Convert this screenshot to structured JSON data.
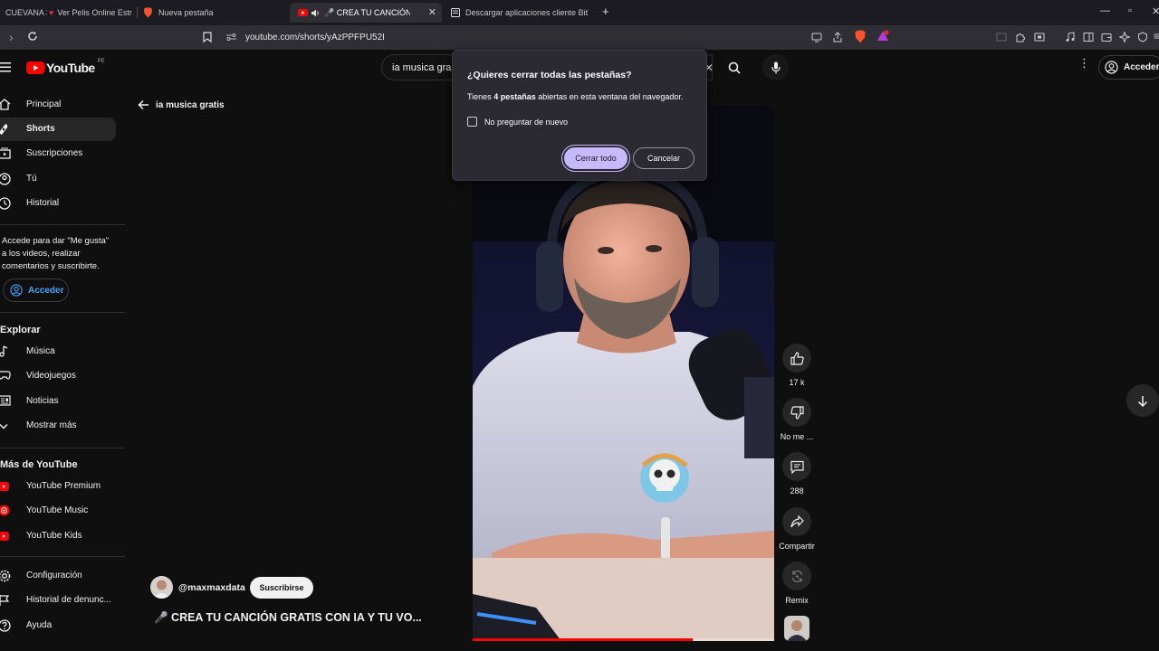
{
  "browser": {
    "tabs": [
      {
        "label": "CUEVANA 3",
        "active": false
      },
      {
        "label": "Ver Pelis Online Estr",
        "active": false
      },
      {
        "label": "Nueva pestaña",
        "active": false
      },
      {
        "label": "🎤 CREA TU CANCIÓN GRAT",
        "active": true
      },
      {
        "label": "Descargar aplicaciones cliente BitTorr",
        "active": false
      }
    ],
    "url": "youtube.com/shorts/yAzPPFPU52I"
  },
  "youtube": {
    "logo_text": "YouTube",
    "region": "PE",
    "search_value": "ia musica gra",
    "signin_label": "Acceder",
    "sidebar": {
      "main": [
        {
          "label": "Principal"
        },
        {
          "label": "Shorts"
        },
        {
          "label": "Suscripciones"
        },
        {
          "label": "Tú"
        },
        {
          "label": "Historial"
        }
      ],
      "prompt": "Accede para dar \"Me gusta\" a los videos, realizar comentarios y suscribirte.",
      "signin_label": "Acceder",
      "explore_title": "Explorar",
      "explore": [
        {
          "label": "Música"
        },
        {
          "label": "Videojuegos"
        },
        {
          "label": "Noticias"
        },
        {
          "label": "Mostrar más"
        }
      ],
      "more_title": "Más de YouTube",
      "more": [
        {
          "label": "YouTube Premium"
        },
        {
          "label": "YouTube Music"
        },
        {
          "label": "YouTube Kids"
        }
      ],
      "settings": [
        {
          "label": "Configuración"
        },
        {
          "label": "Historial de denunc..."
        },
        {
          "label": "Ayuda"
        }
      ]
    },
    "back_label": "ia musica gratis",
    "short": {
      "channel": "@maxmaxdata",
      "subscribe_label": "Suscribirse",
      "title": "🎤 CREA TU CANCIÓN GRATIS CON IA Y TU VO...",
      "progress": 0.73
    },
    "actions": {
      "likes": "17 k",
      "dislike": "No me ...",
      "comments": "288",
      "share": "Compartir",
      "remix": "Remix"
    }
  },
  "dialog": {
    "title": "¿Quieres cerrar todas las pestañas?",
    "msg_prefix": "Tienes ",
    "msg_bold": "4 pestañas",
    "msg_suffix": " abiertas en esta ventana del navegador.",
    "checkbox_label": "No preguntar de nuevo",
    "checkbox_checked": false,
    "confirm_label": "Cerrar todo",
    "cancel_label": "Cancelar"
  },
  "colors": {
    "yt_red": "#ff0000",
    "accent_purple": "#c6b9ff",
    "link_blue": "#3ea6ff"
  }
}
